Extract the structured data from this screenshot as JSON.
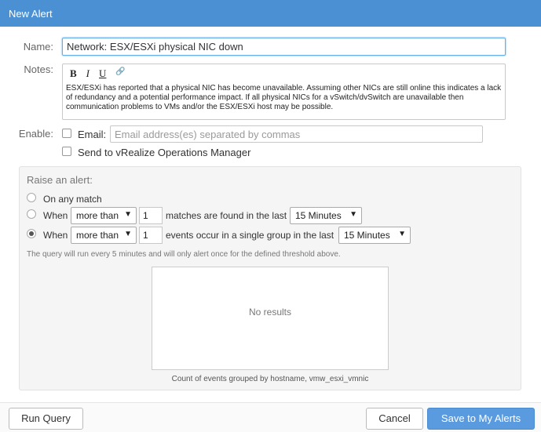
{
  "dialog": {
    "title": "New Alert"
  },
  "form": {
    "name_label": "Name:",
    "name_value": "Network: ESX/ESXi physical NIC down",
    "notes_label": "Notes:",
    "notes_toolbar": {
      "bold": "B",
      "italic": "I",
      "underline": "U",
      "link": "🔗"
    },
    "notes_text": "ESX/ESXi has reported that a physical NIC has become unavailable. Assuming other NICs are still online this indicates a lack of redundancy and a potential performance impact. If all physical NICs for a vSwitch/dvSwitch are unavailable then communication problems to VMs and/or the ESX/ESXi host may be possible.",
    "enable_label": "Enable:",
    "email_label": "Email:",
    "email_placeholder": "Email address(es) separated by commas",
    "vrops_label": "Send to vRealize Operations Manager"
  },
  "alert": {
    "heading": "Raise an alert:",
    "option_any": "On any match",
    "option_when1": {
      "when": "When",
      "operator": "more than",
      "count": "1",
      "text": "matches are found in the last",
      "period": "15 Minutes"
    },
    "option_when2": {
      "when": "When",
      "operator": "more than",
      "count": "1",
      "text": "events occur in a single group in the last",
      "period": "15 Minutes"
    },
    "query_note": "The query will run every 5 minutes and will only alert once for the defined threshold above.",
    "no_results": "No results",
    "caption": "Count of events grouped by hostname, vmw_esxi_vmnic"
  },
  "buttons": {
    "run_query": "Run Query",
    "cancel": "Cancel",
    "save": "Save to My Alerts"
  }
}
